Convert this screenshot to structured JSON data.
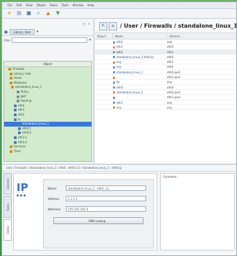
{
  "menubar": {
    "items": [
      "File",
      "Edit",
      "View",
      "Object",
      "Rules",
      "Tools",
      "Window",
      "Help"
    ]
  },
  "left": {
    "toolbar_text": "",
    "tab_label": "Library: User",
    "filter_label": "filter",
    "tree_header": "Object",
    "tree": [
      {
        "label": "Firewalls",
        "indent": 6,
        "icon": "folder"
      },
      {
        "label": "Library: Fwb",
        "indent": 8,
        "icon": "folder"
      },
      {
        "label": "Hosts",
        "indent": 8,
        "icon": "folder"
      },
      {
        "label": "Networks",
        "indent": 8,
        "icon": "folder"
      },
      {
        "label": "standalone_linux_1",
        "indent": 10,
        "icon": "folder"
      },
      {
        "label": "Policy",
        "indent": 18,
        "icon": "grey"
      },
      {
        "label": "NAT",
        "indent": 18,
        "icon": "grey"
      },
      {
        "label": "Routing",
        "indent": 18,
        "icon": "grey"
      },
      {
        "label": "eth0",
        "indent": 14,
        "icon": "blue"
      },
      {
        "label": "eth1",
        "indent": 14,
        "icon": "blue"
      },
      {
        "label": "eth2",
        "indent": 14,
        "icon": "blue"
      },
      {
        "label": "lo",
        "indent": 14,
        "icon": "blue"
      },
      {
        "label": "standalone_linux_1",
        "indent": 20,
        "icon": "blue",
        "selected": true
      },
      {
        "label": "eth0:1",
        "indent": 20,
        "icon": "blue"
      },
      {
        "label": "eth0:2",
        "indent": 20,
        "icon": "blue"
      },
      {
        "label": "eth1:1",
        "indent": 14,
        "icon": "blue"
      },
      {
        "label": "eth1:2",
        "indent": 14,
        "icon": "blue"
      },
      {
        "label": "Services",
        "indent": 8,
        "icon": "folder"
      },
      {
        "label": "Time",
        "indent": 8,
        "icon": "folder"
      }
    ]
  },
  "right": {
    "path": "/ User / Firewalls / standalone_linux_1",
    "columns": [
      "Object",
      "Name",
      "Address"
    ],
    "rows": [
      {
        "c1": "",
        "c2": "eth0",
        "c3": "any"
      },
      {
        "c1": "",
        "c2": "eth1",
        "c3": "eth0"
      },
      {
        "c1": "",
        "c2": "eth2",
        "c3": "eth1",
        "group": true
      },
      {
        "c1": "",
        "c2": "standalone_linux_1:eth0:ip",
        "c3": "eth0"
      },
      {
        "c1": "",
        "c2": "any",
        "c3": "eth1"
      },
      {
        "c1": "",
        "c2": "any",
        "c3": "eth0"
      },
      {
        "c1": "",
        "c2": "standalone_linux_1",
        "c3": "eth0.ipv4"
      },
      {
        "c1": "",
        "c2": "",
        "c3": "eth1.ipv4"
      },
      {
        "c1": "",
        "c2": "fw",
        "c3": "any"
      },
      {
        "c1": "",
        "c2": "eth0",
        "c3": "eth0"
      },
      {
        "c1": "",
        "c2": "standalone_linux_1",
        "c3": "eth0.ipv4"
      },
      {
        "c1": "",
        "c2": "",
        "c3": "eth1.ipv4"
      },
      {
        "c1": "",
        "c2": "eth1",
        "c3": "any"
      },
      {
        "c1": "",
        "c2": "any",
        "c3": "any"
      }
    ]
  },
  "bottom": {
    "path": "User / Firewalls / standalone_linux_1 / eth0 : eth0:1:2 / standalone_linux_1 : eth0:ip",
    "vtabs": [
      "General",
      "Rules",
      "Editor"
    ],
    "logo_text": "IP",
    "form": {
      "name_label": "Name:",
      "name_value": "standalone_linux_1 : eth0 : ip",
      "address_label": "Address:",
      "address_value": "1.1.1.1",
      "netmask_label": "Netmask:",
      "netmask_value": "255.255.255.0",
      "dns_button": "DNS Lookup..."
    },
    "comment_label": "Comment:"
  }
}
